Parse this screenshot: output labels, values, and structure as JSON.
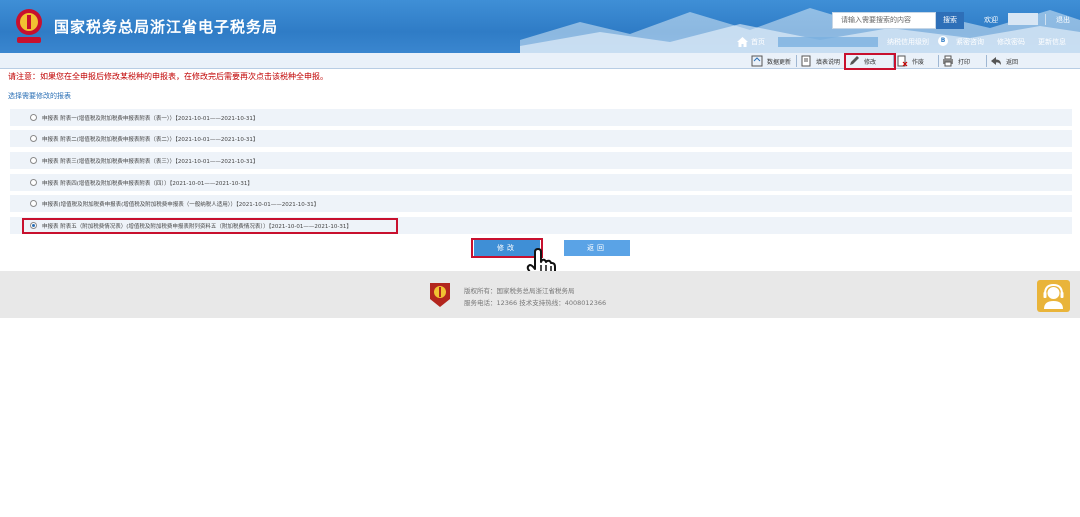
{
  "header": {
    "site_title": "国家税务总局浙江省电子税务局",
    "search_placeholder": "请输入需要搜索的内容",
    "search_button": "搜索",
    "welcome": "欢迎",
    "logout": "退出"
  },
  "nav": {
    "home": "首页",
    "credit_level": "纳税信用级别",
    "credit_badge": "B",
    "links": [
      "紧密咨询",
      "修改密码",
      "更新信息"
    ]
  },
  "toolbar": {
    "items": [
      "数据更新",
      "填表说明",
      "修改",
      "作废",
      "打印",
      "返回"
    ]
  },
  "content": {
    "notice": "请注意：如果您在全申报后修改某税种的申报表，在修改完后需要再次点击该税种全申报。",
    "section_title": "选择需要修改的报表",
    "reports": [
      {
        "label": "申报表 附表一(增值税及附加税费申报表附表（表一））【2021-10-01——2021-10-31】",
        "checked": false
      },
      {
        "label": "申报表 附表二(增值税及附加税费申报表附表（表二））【2021-10-01——2021-10-31】",
        "checked": false
      },
      {
        "label": "申报表 附表三(增值税及附加税费申报表附表（表三））【2021-10-01——2021-10-31】",
        "checked": false
      },
      {
        "label": "申报表 附表四(增值税及附加税费申报表附表（四））【2021-10-01——2021-10-31】",
        "checked": false
      },
      {
        "label": "申报表(增值税及附加税费申报表(增值税及附加税费申报表（一般纳税人适用））【2021-10-01——2021-10-31】",
        "checked": false
      },
      {
        "label": "申报表 附表五（附加税费情况表）(增值税及附加税费申报表附列资料五（附加税费情况表））【2021-10-01——2021-10-31】",
        "checked": true
      }
    ],
    "modify_button": "修改",
    "back_button": "返回"
  },
  "footer": {
    "copyright": "版权所有：国家税务总局浙江省税务局",
    "service": "服务电话：12366 技术支持热线：4008012366"
  },
  "colors": {
    "header_blue": "#2f7cc6",
    "highlight_red": "#c8102e",
    "notice_red": "#c00000",
    "button_blue": "#3f8fd6"
  }
}
